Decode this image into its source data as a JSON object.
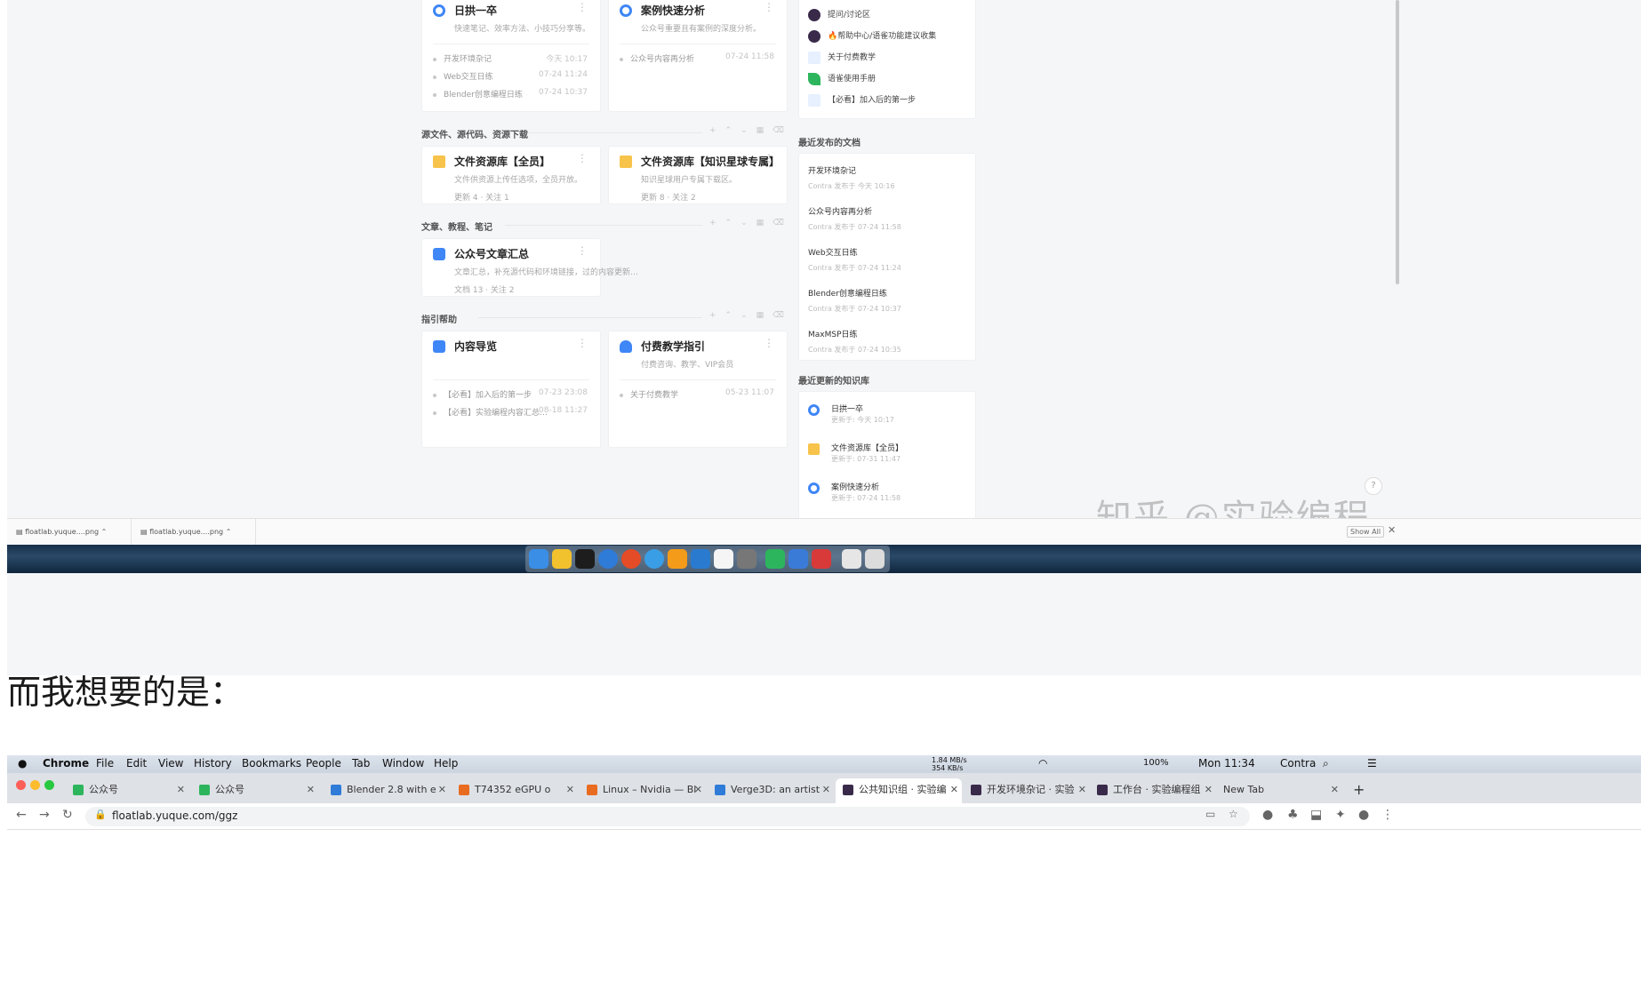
{
  "top_shot": {
    "cards": [
      {
        "title": "日拱一卒",
        "desc": "快速笔记、效率方法、小技巧分享等。",
        "icon": "circle-book-icon",
        "docs": [
          {
            "name": "开发环境杂记",
            "time": "今天 10:17"
          },
          {
            "name": "Web交互日练",
            "time": "07-24 11:24"
          },
          {
            "name": "Blender创意编程日练",
            "time": "07-24 10:37"
          }
        ]
      },
      {
        "title": "案例快速分析",
        "desc": "公众号重要且有案例的深度分析。",
        "icon": "circle-book-icon",
        "docs": [
          {
            "name": "公众号内容再分析",
            "time": "07-24 11:58"
          }
        ]
      },
      {
        "title": "文件资源库【全员】",
        "desc": "文件供资源上传任选项，全员开放。",
        "meta": "更新 4 · 关注 1",
        "icon": "folder-icon"
      },
      {
        "title": "文件资源库【知识星球专属】",
        "desc": "知识星球用户专属下载区。",
        "meta": "更新 8 · 关注 2",
        "icon": "folder-icon"
      },
      {
        "title": "公众号文章汇总",
        "desc": "文章汇总，补充源代码和环境链接，过的内容更新…",
        "meta": "文档 13 · 关注 2",
        "icon": "book-icon"
      },
      {
        "title": "内容导览",
        "desc": "",
        "icon": "book-icon",
        "docs": [
          {
            "name": "【必看】加入后的第一步",
            "time": "07-23 23:08"
          },
          {
            "name": "【必看】实验编程内容汇总…",
            "time": "08-18 11:27"
          }
        ]
      },
      {
        "title": "付费教学指引",
        "desc": "付费咨询、教学、VIP会员",
        "icon": "user-icon",
        "docs": [
          {
            "name": "关于付费教学",
            "time": "05-23 11:07"
          }
        ]
      }
    ],
    "sections": [
      "源文件、源代码、资源下载",
      "文章、教程、笔记",
      "指引帮助"
    ],
    "sidebar_links": [
      {
        "label": "提问/讨论区",
        "icon": "discussion-icon"
      },
      {
        "label": "🔥帮助中心/语雀功能建议收集",
        "icon": "help-center-icon"
      },
      {
        "label": "关于付费教学",
        "icon": "doc-icon"
      },
      {
        "label": "语雀使用手册",
        "icon": "leaf-icon"
      },
      {
        "label": "【必看】加入后的第一步",
        "icon": "doc-icon"
      }
    ],
    "recent_docs_title": "最近发布的文档",
    "recent_docs": [
      {
        "title": "开发环境杂记",
        "meta": "Contra 发布于 今天 10:16"
      },
      {
        "title": "公众号内容再分析",
        "meta": "Contra 发布于 07-24 11:58"
      },
      {
        "title": "Web交互日练",
        "meta": "Contra 发布于 07-24 11:24"
      },
      {
        "title": "Blender创意编程日练",
        "meta": "Contra 发布于 07-24 10:37"
      },
      {
        "title": "MaxMSP日练",
        "meta": "Contra 发布于 07-24 10:35"
      }
    ],
    "recent_kb_title": "最近更新的知识库",
    "recent_kb": [
      {
        "title": "日拱一卒",
        "meta": "更新于: 今天 10:17",
        "icon": "circle-book-icon"
      },
      {
        "title": "文件资源库【全员】",
        "meta": "更新于: 07-31 11:47",
        "icon": "folder-icon"
      },
      {
        "title": "案例快速分析",
        "meta": "更新于: 07-24 11:58",
        "icon": "circle-book-icon"
      }
    ],
    "downloads": [
      "floatlab.yuque....png",
      "floatlab.yuque....png"
    ],
    "show_all": "Show All",
    "watermark": "知乎 @实验编程",
    "help": "?"
  },
  "caption": "而我想要的是：",
  "bottom_shot": {
    "menubar": [
      "Chrome",
      "File",
      "Edit",
      "View",
      "History",
      "Bookmarks",
      "People",
      "Tab",
      "Window",
      "Help"
    ],
    "status": {
      "net": "1.84 MB/s 354 KB/s",
      "battery": "100%",
      "clock": "Mon 11:34",
      "user": "Contra"
    },
    "tabs": [
      {
        "label": "公众号",
        "color": "#2db55d"
      },
      {
        "label": "公众号",
        "color": "#2db55d"
      },
      {
        "label": "Blender 2.8 with e",
        "color": "#2f7bd8"
      },
      {
        "label": "T74352 eGPU o",
        "color": "#e86b1f"
      },
      {
        "label": "Linux – Nvidia — Bl",
        "color": "#e86b1f"
      },
      {
        "label": "Verge3D: an artist",
        "color": "#2f7bd8"
      },
      {
        "label": "公共知识组 · 实验编",
        "color": "#3a2a4a"
      },
      {
        "label": "开发环境杂记 · 实验",
        "color": "#3a2a4a"
      },
      {
        "label": "工作台 · 实验编程组",
        "color": "#3a2a4a"
      },
      {
        "label": "New Tab",
        "color": "#ffffff"
      }
    ],
    "url": "floatlab.yuque.com/ggz"
  }
}
